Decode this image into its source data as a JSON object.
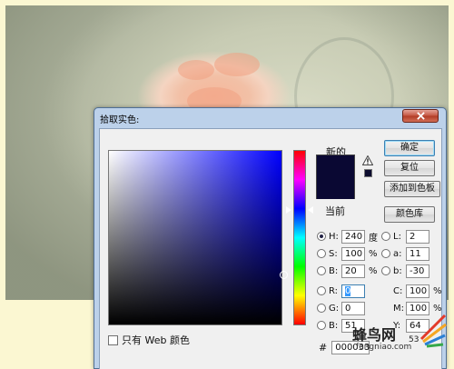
{
  "dialog": {
    "title": "拾取实色:",
    "new_label": "新的",
    "current_label": "当前",
    "web_only_label": "只有 Web 颜色",
    "new_color": "#0a0833",
    "current_color": "#0a0833"
  },
  "buttons": {
    "ok": "确定",
    "reset": "复位",
    "add_to_swatches": "添加到色板",
    "color_libraries": "颜色库"
  },
  "hsb": {
    "h": {
      "label": "H:",
      "value": "240",
      "unit": "度"
    },
    "s": {
      "label": "S:",
      "value": "100",
      "unit": "%"
    },
    "b": {
      "label": "B:",
      "value": "20",
      "unit": "%"
    }
  },
  "rgb": {
    "r": {
      "label": "R:",
      "value": "0"
    },
    "g": {
      "label": "G:",
      "value": "0"
    },
    "b": {
      "label": "B:",
      "value": "51"
    }
  },
  "lab": {
    "l": {
      "label": "L:",
      "value": "2"
    },
    "a": {
      "label": "a:",
      "value": "11"
    },
    "b": {
      "label": "b:",
      "value": "-30"
    }
  },
  "cmyk": {
    "c": {
      "label": "C:",
      "value": "100",
      "unit": "%"
    },
    "m": {
      "label": "M:",
      "value": "100",
      "unit": "%"
    },
    "y": {
      "label": "Y:",
      "value": "64"
    }
  },
  "hex": {
    "label": "#",
    "value": "000033"
  },
  "watermark": {
    "text": "蜂鸟网",
    "sub": "fengniao.com",
    "tail": "53"
  },
  "icons": {
    "close": "close-icon",
    "gamut_warning": "warning-triangle-icon",
    "web_cube": "web-cube-icon",
    "logo": "feather-logo-icon"
  }
}
